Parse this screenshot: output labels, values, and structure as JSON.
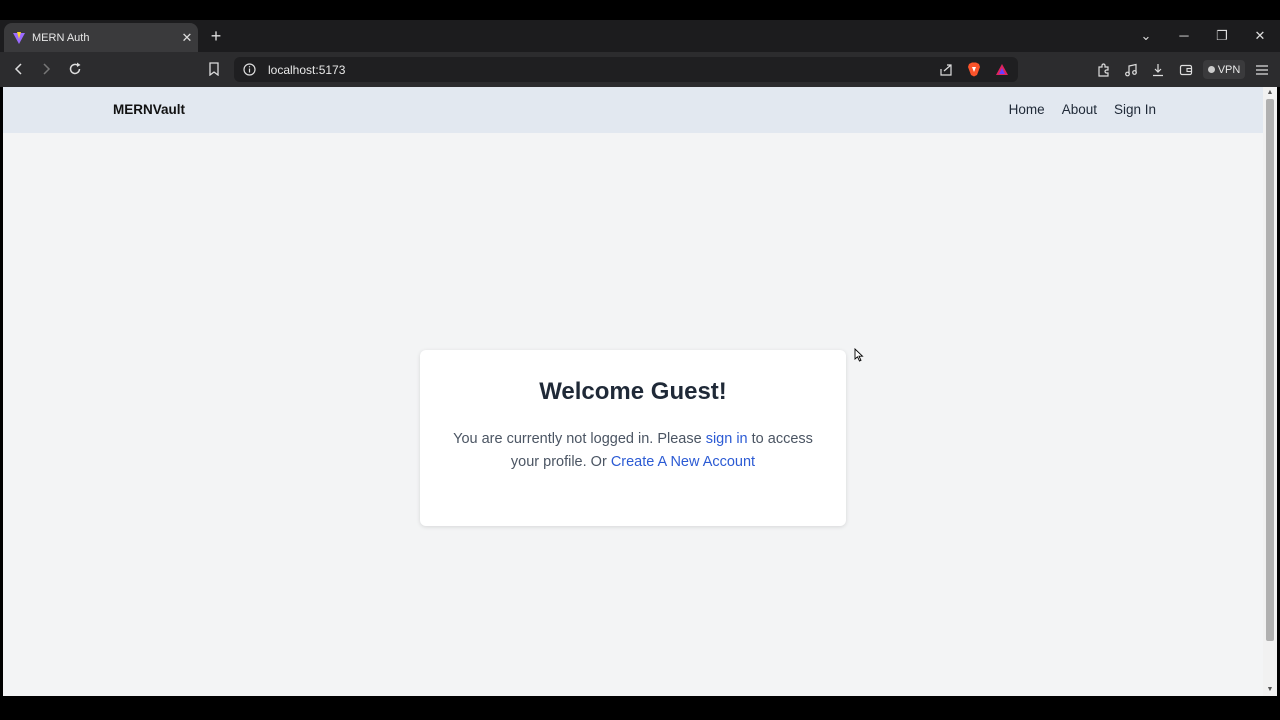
{
  "browser": {
    "tab": {
      "title": "MERN Auth",
      "favicon": "vite-icon"
    },
    "url": "localhost:5173",
    "vpn_label": "VPN"
  },
  "site": {
    "brand": "MERNVault",
    "nav": [
      {
        "label": "Home"
      },
      {
        "label": "About"
      },
      {
        "label": "Sign In"
      }
    ]
  },
  "card": {
    "title": "Welcome Guest!",
    "text_before": "You are currently not logged in. Please ",
    "signin_link": "sign in",
    "text_middle": " to access your profile. Or ",
    "create_link": "Create A New Account"
  },
  "colors": {
    "link": "#2c5bd4",
    "header_bg": "#e2e8f0",
    "page_bg": "#f3f4f5",
    "brave_orange": "#fb542b"
  }
}
